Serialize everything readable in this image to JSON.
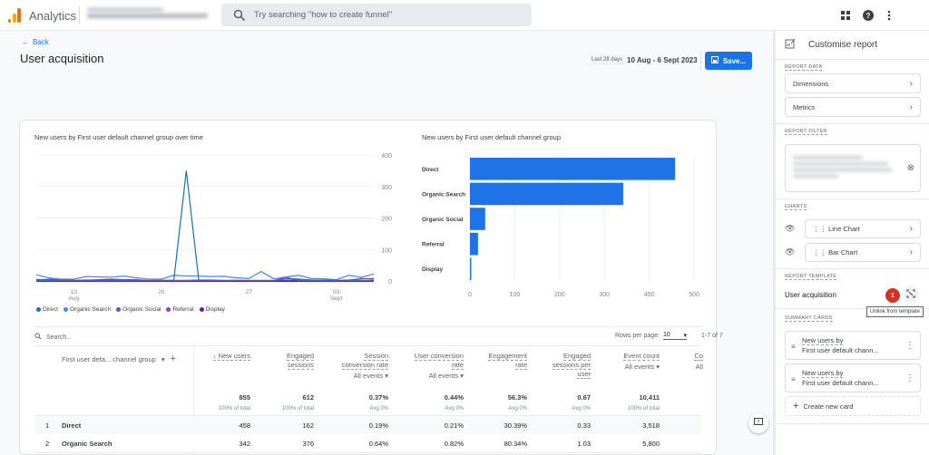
{
  "topbar": {
    "app_name": "Analytics",
    "search_placeholder": "Try searching \"how to create funnel\"",
    "icons": [
      "apps-grid-icon",
      "help-icon",
      "more-vert-icon"
    ]
  },
  "header": {
    "back_label": "Back",
    "title": "User acquisition",
    "date_preset": "Last 28 days",
    "date_range": "10 Aug - 6 Sept 2023",
    "save_label": "Save..."
  },
  "colors": {
    "accent": "#1a73e8",
    "bar": "#1f73e6",
    "badge": "#d93025"
  },
  "chart_data": [
    {
      "type": "line",
      "title": "New users by First user default channel group over time",
      "x_ticks": [
        {
          "label": "13",
          "sub": "Aug",
          "day": 13
        },
        {
          "label": "20",
          "sub": "",
          "day": 20
        },
        {
          "label": "27",
          "sub": "",
          "day": 27
        },
        {
          "label": "03",
          "sub": "Sept",
          "day": 34
        }
      ],
      "x_range": [
        10,
        37
      ],
      "y_ticks": [
        0,
        100,
        200,
        300,
        400
      ],
      "ylim": [
        0,
        400
      ],
      "y_axis_side": "right",
      "grid": true,
      "legend_position": "bottom-left",
      "series": [
        {
          "name": "Direct",
          "color": "#1a6fb8",
          "values": [
            5,
            3,
            2,
            2,
            3,
            3,
            3,
            3,
            2,
            2,
            2,
            2,
            350,
            2,
            2,
            2,
            2,
            2,
            2,
            2,
            3,
            3,
            3,
            3,
            2,
            3,
            6,
            8
          ]
        },
        {
          "name": "Organic Search",
          "color": "#4285f4",
          "values": [
            20,
            10,
            6,
            6,
            14,
            13,
            12,
            16,
            10,
            6,
            6,
            18,
            16,
            16,
            14,
            15,
            10,
            8,
            30,
            7,
            13,
            18,
            8,
            7,
            4,
            18,
            12,
            22
          ]
        },
        {
          "name": "Organic Social",
          "color": "#5b4ee8",
          "values": [
            2,
            6,
            3,
            2,
            2,
            4,
            6,
            4,
            4,
            1,
            2,
            2,
            2,
            3,
            3,
            1,
            2,
            1,
            1,
            1,
            8,
            6,
            3,
            2,
            1,
            2,
            8,
            5
          ]
        },
        {
          "name": "Referral",
          "color": "#8e3ce0",
          "values": [
            1,
            1,
            1,
            1,
            1,
            1,
            1,
            1,
            1,
            1,
            1,
            1,
            1,
            1,
            1,
            1,
            1,
            1,
            1,
            1,
            12,
            1,
            1,
            1,
            1,
            1,
            1,
            1
          ]
        },
        {
          "name": "Display",
          "color": "#6a1b9a",
          "values": [
            0,
            0,
            0,
            0,
            0,
            0,
            0,
            0,
            0,
            0,
            0,
            0,
            0,
            0,
            0,
            0,
            0,
            0,
            0,
            0,
            0,
            0,
            0,
            0,
            0,
            0,
            0,
            0
          ]
        }
      ]
    },
    {
      "type": "bar",
      "orientation": "horizontal",
      "title": "New users by First user default channel group",
      "categories": [
        "Direct",
        "Organic Search",
        "Organic Social",
        "Referral",
        "Display"
      ],
      "values": [
        458,
        342,
        34,
        18,
        3
      ],
      "x_ticks": [
        0,
        100,
        200,
        300,
        400,
        500
      ],
      "xlim": [
        0,
        500
      ],
      "grid": true
    }
  ],
  "table": {
    "search_placeholder": "Search...",
    "rows_per_page_label": "Rows per page:",
    "rows_per_page": "10",
    "pagination": "1-7 of 7",
    "dimension_header": "First user defa... channel group",
    "columns": [
      {
        "label": [
          "↓ New users"
        ],
        "sub": "",
        "total": "855",
        "total_note": "100% of total"
      },
      {
        "label": [
          "Engaged",
          "sessions"
        ],
        "sub": "",
        "total": "612",
        "total_note": "100% of total"
      },
      {
        "label": [
          "Session",
          "conversion rate"
        ],
        "sub": "All events ▾",
        "total": "0.37%",
        "total_note": "Avg 0%"
      },
      {
        "label": [
          "User conversion",
          "rate"
        ],
        "sub": "All events ▾",
        "total": "0.44%",
        "total_note": "Avg 0%"
      },
      {
        "label": [
          "Engagement",
          "rate"
        ],
        "sub": "",
        "total": "56.3%",
        "total_note": "Avg 0%"
      },
      {
        "label": [
          "Engaged",
          "sessions per",
          "user"
        ],
        "sub": "",
        "total": "0.67",
        "total_note": "Avg 0%"
      },
      {
        "label": [
          "Event count"
        ],
        "sub": "All events ▾",
        "total": "10,411",
        "total_note": "100% of total"
      },
      {
        "label": [
          "Co"
        ],
        "sub": "All",
        "total": "",
        "total_note": ""
      }
    ],
    "rows": [
      {
        "index": "1",
        "name": "Direct",
        "values": [
          "458",
          "162",
          "0.19%",
          "0.21%",
          "30.39%",
          "0.33",
          "3,518"
        ]
      },
      {
        "index": "2",
        "name": "Organic Search",
        "values": [
          "342",
          "376",
          "0.64%",
          "0.82%",
          "80.34%",
          "1.03",
          "5,800"
        ]
      }
    ]
  },
  "panel": {
    "title": "Customise report",
    "report_data_label": "REPORT DATA",
    "dimensions_label": "Dimensions",
    "metrics_label": "Metrics",
    "report_filter_label": "REPORT FILTER",
    "charts_label": "CHARTS",
    "charts": [
      "Line Chart",
      "Bar Chart"
    ],
    "report_template_label": "REPORT TEMPLATE",
    "template_name": "User acquisition",
    "badge": "1",
    "tooltip": "Unlink from template",
    "summary_cards_label": "SUMMARY CARDS",
    "summary_cards": [
      {
        "line1": "New users by",
        "line2": "First user default chann..."
      },
      {
        "line1": "New users by",
        "line2": "First user default chann..."
      }
    ],
    "create_card_label": "Create new card"
  }
}
